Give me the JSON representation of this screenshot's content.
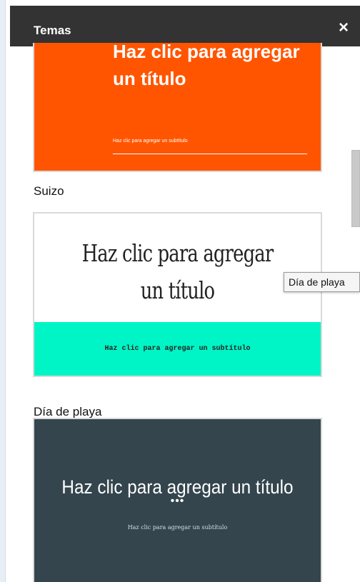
{
  "header": {
    "title": "Temas",
    "close_glyph": "×"
  },
  "themes": [
    {
      "name": "Suizo",
      "title": "Haz clic para agregar un título",
      "subtitle": "Haz clic para agregar un subtítulo",
      "background": "#ff5500"
    },
    {
      "name": "Día de playa",
      "title": "Haz clic para agregar un título",
      "subtitle": "Haz clic para agregar un subtítulo",
      "accent": "#00f5c6"
    },
    {
      "name": "",
      "title": "Haz clic para agregar un título",
      "dots": "•••",
      "subtitle": "Haz clic para agregar un subtítulo",
      "background": "#34454e"
    }
  ],
  "tooltip": {
    "text": "Día de playa"
  }
}
